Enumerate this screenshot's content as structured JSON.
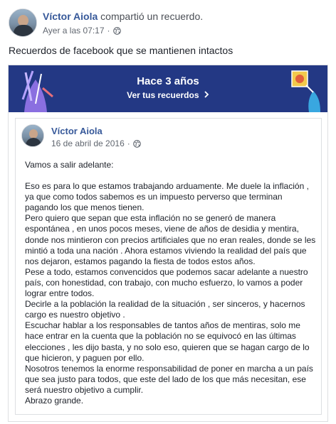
{
  "post": {
    "author": "Víctor Aiola",
    "action": "compartió un recuerdo.",
    "timestamp": "Ayer a las 07:17",
    "separator": "·",
    "privacy_icon": "globe-icon",
    "text": "Recuerdos de facebook que se mantienen intactos"
  },
  "memory": {
    "title": "Hace 3 años",
    "link": "Ver tus recuerdos",
    "link_icon": "chevron-right-icon",
    "banner_color": "#233884",
    "inner": {
      "author": "Víctor Aiola",
      "date": "16 de abril de 2016",
      "separator": "·",
      "privacy_icon": "globe-icon",
      "paragraphs": [
        "Vamos a salir adelante:",
        "",
        "Eso es para lo que estamos trabajando arduamente. Me duele la inflación , ya que como todos sabemos es un impuesto perverso que terminan pagando los que menos tienen.",
        "Pero quiero que sepan que esta inflación no se generó de manera espontánea , en unos pocos meses, viene de años de desidia y mentira, donde nos mintieron con precios artificiales que no eran reales, donde se les mintió a toda una nación . Ahora estamos viviendo la realidad del país que nos dejaron, estamos pagando la fiesta de todos estos años.",
        "Pese a todo, estamos convencidos que podemos sacar adelante a nuestro país, con honestidad, con trabajo, con mucho esfuerzo, lo vamos a poder lograr entre todos.",
        "Decirle a la población la realidad de la situación , ser sinceros, y hacernos cargo es nuestro objetivo .",
        "Escuchar hablar a los responsables de tantos años de mentiras, solo me hace entrar en la cuenta que la población no se equivocó en las últimas elecciones , les dijo basta, y no solo eso, quieren que se hagan cargo de lo que hicieron, y paguen por ello.",
        "Nosotros tenemos la enorme responsabilidad de poner en marcha a un país que sea justo para todos, que este del lado de los que más necesitan, ese será nuestro objetivo a cumplir.",
        "Abrazo grande."
      ]
    }
  }
}
